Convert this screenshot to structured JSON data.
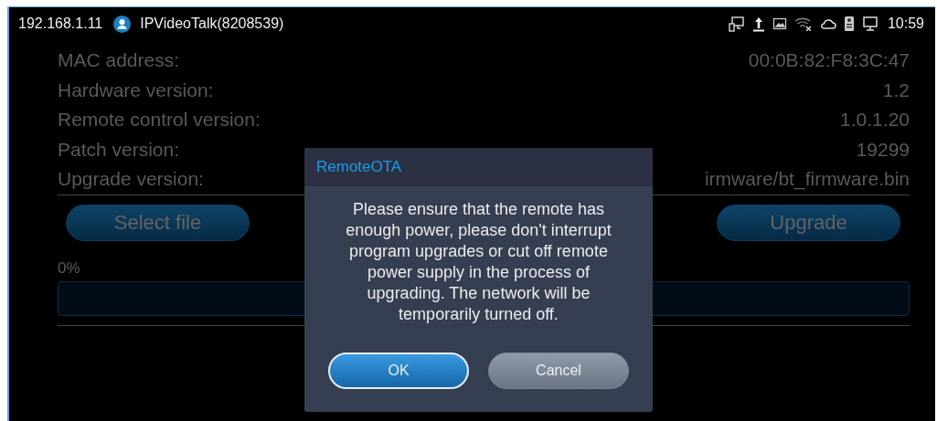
{
  "status_bar": {
    "ip": "192.168.1.11",
    "account": "IPVideoTalk(8208539)",
    "time": "10:59"
  },
  "info_rows": [
    {
      "label": "MAC address:",
      "value": "00:0B:82:F8:3C:47"
    },
    {
      "label": "Hardware version:",
      "value": "1.2"
    },
    {
      "label": "Remote control version:",
      "value": "1.0.1.20"
    },
    {
      "label": "Patch version:",
      "value": "19299"
    },
    {
      "label": "Upgrade version:",
      "value": "irmware/bt_firmware.bin"
    }
  ],
  "buttons": [
    {
      "label": "Select file"
    },
    {
      "label": "Upgrade"
    }
  ],
  "progress": {
    "reading": "0%",
    "level": 0
  },
  "dialog": {
    "title": "RemoteOTA",
    "message": "Please ensure that the remote has enough power, please don't interrupt program upgrades or cut off remote power supply in the process of upgrading. The network will be temporarily turned off.",
    "buttons": [
      {
        "label": "OK",
        "kind": "primary"
      },
      {
        "label": "Cancel",
        "kind": "secondary"
      }
    ]
  }
}
